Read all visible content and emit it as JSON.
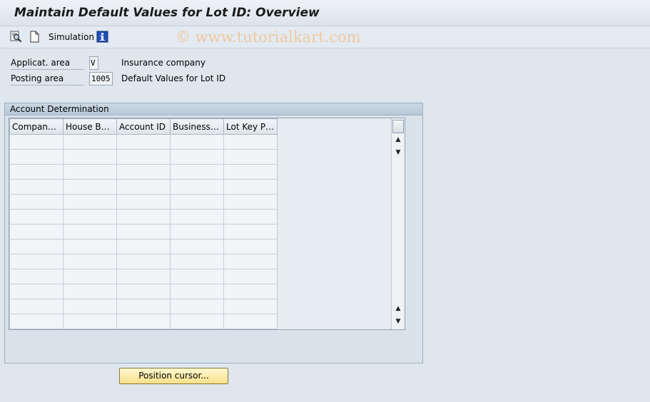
{
  "window": {
    "title": "Maintain Default Values for Lot ID: Overview"
  },
  "toolbar": {
    "simulation_label": "Simulation",
    "watermark": "© www.tutorialkart.com",
    "icons": [
      "find-icon",
      "new-document-icon",
      "info-icon"
    ]
  },
  "fields": {
    "applicat_area": {
      "label": "Applicat. area",
      "value": "V",
      "description": "Insurance company"
    },
    "posting_area": {
      "label": "Posting area",
      "value": "1005",
      "description": "Default Values for Lot ID"
    }
  },
  "account_determination": {
    "title": "Account Determination",
    "columns": [
      "Company ...",
      "House Bank",
      "Account ID",
      "Business T...",
      "Lot Key Pr..."
    ],
    "rows": [
      [
        "",
        "",
        "",
        "",
        ""
      ],
      [
        "",
        "",
        "",
        "",
        ""
      ],
      [
        "",
        "",
        "",
        "",
        ""
      ],
      [
        "",
        "",
        "",
        "",
        ""
      ],
      [
        "",
        "",
        "",
        "",
        ""
      ],
      [
        "",
        "",
        "",
        "",
        ""
      ],
      [
        "",
        "",
        "",
        "",
        ""
      ],
      [
        "",
        "",
        "",
        "",
        ""
      ],
      [
        "",
        "",
        "",
        "",
        ""
      ],
      [
        "",
        "",
        "",
        "",
        ""
      ],
      [
        "",
        "",
        "",
        "",
        ""
      ],
      [
        "",
        "",
        "",
        "",
        ""
      ],
      [
        "",
        "",
        "",
        "",
        ""
      ]
    ]
  },
  "buttons": {
    "position_cursor": "Position cursor..."
  },
  "colors": {
    "background": "#dfe6ed",
    "button_yellow": "#f7e089",
    "info_icon_blue": "#1f4fb8",
    "watermark": "#f0c8a0"
  }
}
